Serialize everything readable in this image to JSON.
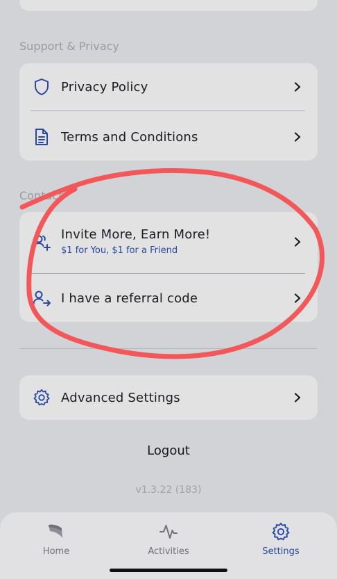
{
  "support_section": {
    "title": "Support & Privacy",
    "items": [
      {
        "label": "Privacy Policy",
        "icon": "shield-icon"
      },
      {
        "label": "Terms and Conditions",
        "icon": "document-icon"
      }
    ]
  },
  "contact_section": {
    "title": "Contact",
    "items": [
      {
        "label": "Invite More, Earn More!",
        "sublabel": "$1 for You, $1 for a Friend",
        "icon": "invite-user-icon"
      },
      {
        "label": "I have a referral code",
        "icon": "referral-user-icon"
      }
    ]
  },
  "advanced": {
    "label": "Advanced Settings",
    "icon": "gear-icon"
  },
  "logout_label": "Logout",
  "version": "v1.3.22 (183)",
  "tabs": [
    {
      "label": "Home",
      "icon": "home-logo-icon",
      "active": false
    },
    {
      "label": "Activities",
      "icon": "activity-icon",
      "active": false
    },
    {
      "label": "Settings",
      "icon": "gear-icon",
      "active": true
    }
  ],
  "colors": {
    "background": "#d2d3d7",
    "card": "#e2e2e3",
    "accent": "#2748a5",
    "annotation": "#f2575a",
    "inactive_tab": "#6f7079"
  }
}
